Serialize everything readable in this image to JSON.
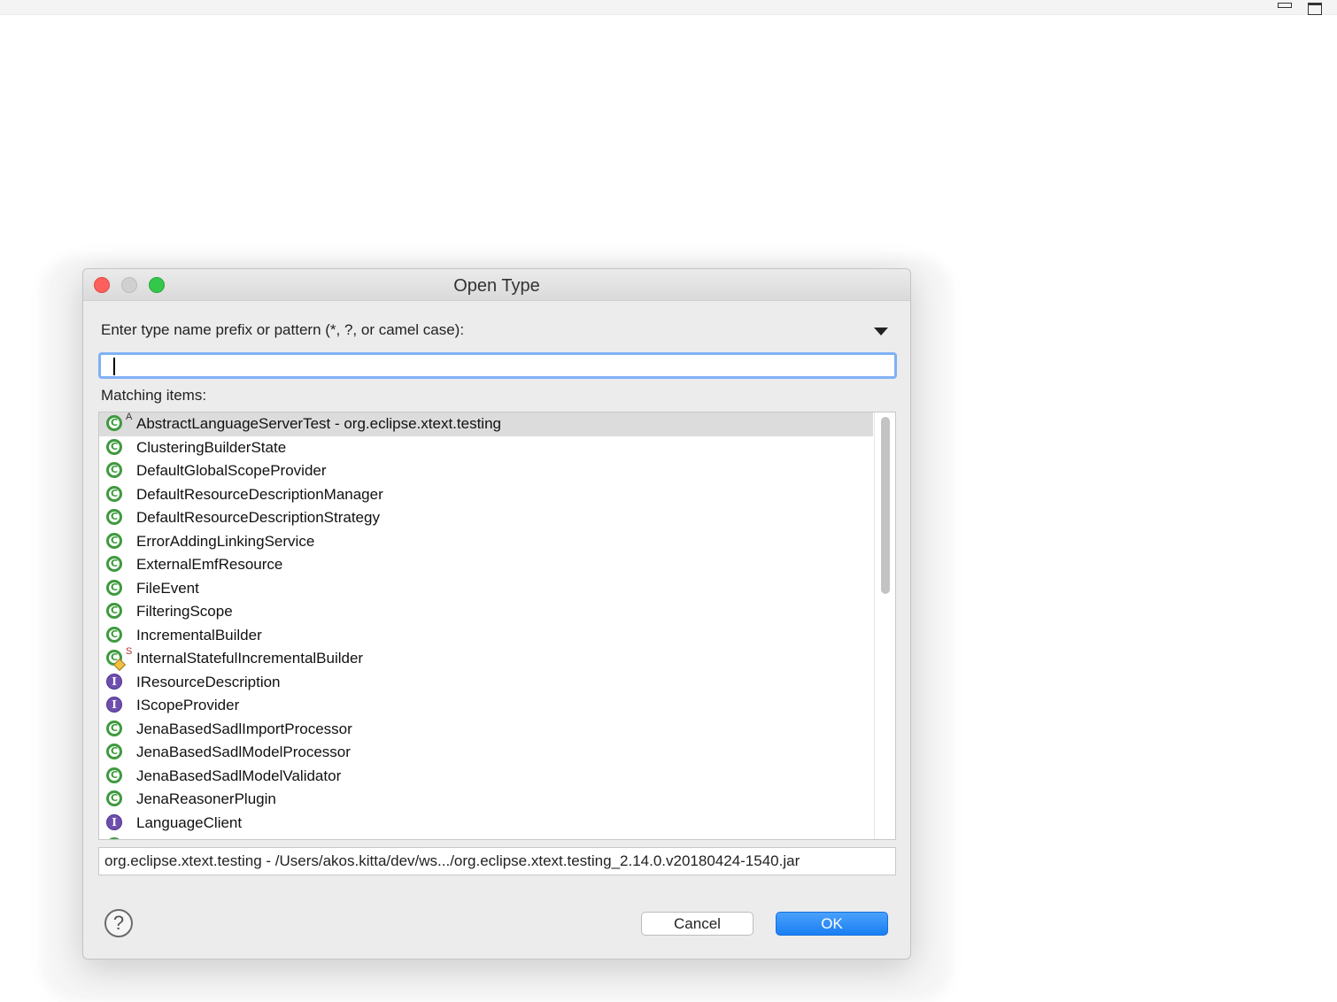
{
  "dialog": {
    "title": "Open Type",
    "prompt": "Enter type name prefix or pattern (*, ?, or camel case):",
    "pattern_value": "",
    "matching_label": "Matching items:",
    "items": [
      {
        "label": "AbstractLanguageServerTest - org.eclipse.xtext.testing",
        "icon": "class-icon",
        "overlay": "A",
        "selected": true
      },
      {
        "label": "ClusteringBuilderState",
        "icon": "class-icon"
      },
      {
        "label": "DefaultGlobalScopeProvider",
        "icon": "class-icon"
      },
      {
        "label": "DefaultResourceDescriptionManager",
        "icon": "class-icon"
      },
      {
        "label": "DefaultResourceDescriptionStrategy",
        "icon": "class-icon"
      },
      {
        "label": "ErrorAddingLinkingService",
        "icon": "class-icon"
      },
      {
        "label": "ExternalEmfResource",
        "icon": "class-icon"
      },
      {
        "label": "FileEvent",
        "icon": "class-icon"
      },
      {
        "label": "FilteringScope",
        "icon": "class-icon"
      },
      {
        "label": "IncrementalBuilder",
        "icon": "class-icon"
      },
      {
        "label": "InternalStatefulIncrementalBuilder",
        "icon": "class-icon",
        "overlay": "S"
      },
      {
        "label": "IResourceDescription",
        "icon": "interface-icon"
      },
      {
        "label": "IScopeProvider",
        "icon": "interface-icon"
      },
      {
        "label": "JenaBasedSadlImportProcessor",
        "icon": "class-icon"
      },
      {
        "label": "JenaBasedSadlModelProcessor",
        "icon": "class-icon"
      },
      {
        "label": "JenaBasedSadlModelValidator",
        "icon": "class-icon"
      },
      {
        "label": "JenaReasonerPlugin",
        "icon": "class-icon"
      },
      {
        "label": "LanguageClient",
        "icon": "interface-icon"
      },
      {
        "label": "",
        "icon": "class-icon"
      }
    ],
    "details_path": "org.eclipse.xtext.testing - /Users/akos.kitta/dev/ws.../org.eclipse.xtext.testing_2.14.0.v20180424-1540.jar",
    "help_label": "?",
    "cancel_label": "Cancel",
    "ok_label": "OK"
  },
  "colors": {
    "class_icon": "#3e9a3e",
    "interface_icon": "#6e4fae",
    "ok_button": "#1a7ff3",
    "focus_ring": "#7fb1f5"
  }
}
